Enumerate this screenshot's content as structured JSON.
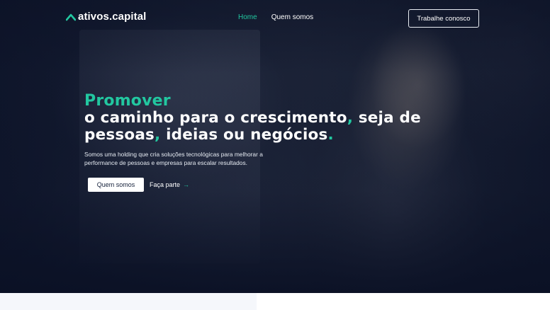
{
  "brand": {
    "name": "ativos.capital",
    "logo_icon": "chevron-up-logo-icon",
    "accent_color": "#22c7a0"
  },
  "nav": {
    "items": [
      {
        "label": "Home",
        "active": true
      },
      {
        "label": "Quem somos",
        "active": false
      }
    ],
    "cta_label": "Trabalhe conosco"
  },
  "hero": {
    "headline_accent": "Promover",
    "line1_text": "o caminho para o crescimento",
    "line1_punct": ",",
    "line1_tail": " seja de",
    "line2_a": "pessoas",
    "line2_punct": ",",
    "line2_tail": " ideias ou negócios",
    "line2_end": ".",
    "subtext": "Somos uma holding que cria soluções tecnológicas para melhorar a performance de pessoas e empresas para escalar resultados.",
    "primary_button": "Quem somos",
    "secondary_link": "Faça parte",
    "secondary_arrow": "→"
  }
}
